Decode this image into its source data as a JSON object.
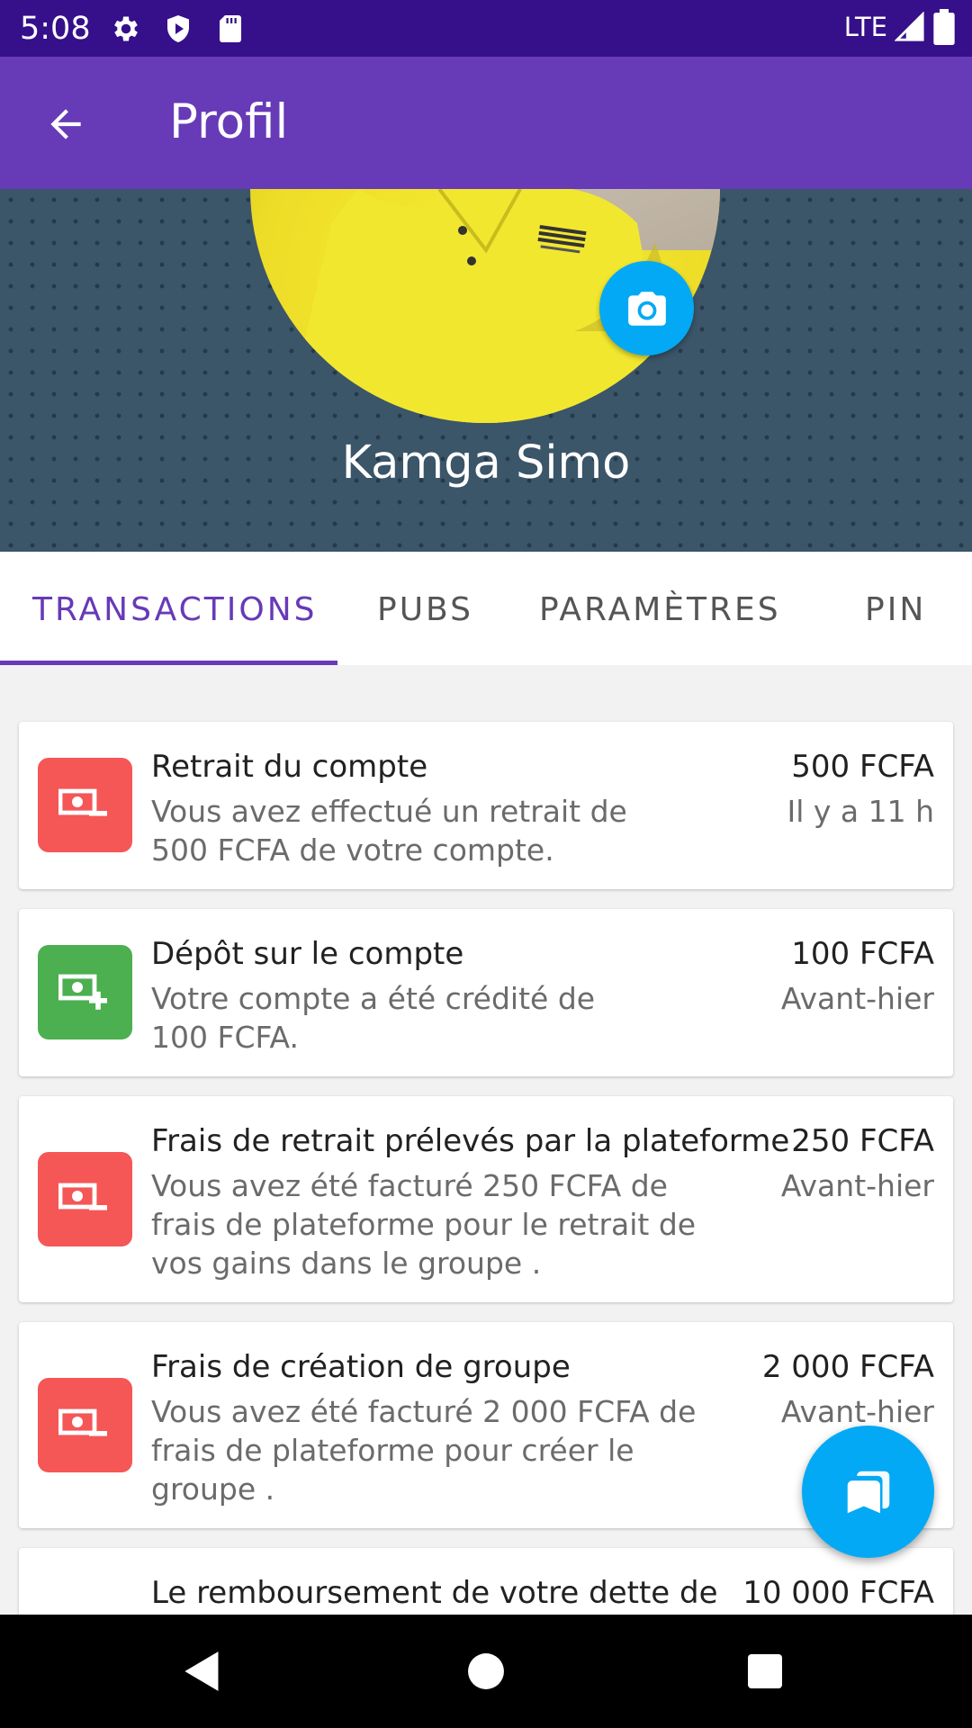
{
  "status_bar": {
    "time": "5:08",
    "network": "LTE",
    "icons": [
      "settings-icon",
      "shield-play-icon",
      "sd-card-icon",
      "signal-icon",
      "battery-icon"
    ]
  },
  "app_bar": {
    "title": "Profil",
    "back_icon": "arrow-back-icon",
    "color": "#673ab7"
  },
  "profile": {
    "name": "Kamga Simo",
    "camera_icon": "camera-icon"
  },
  "tabs": [
    {
      "label": "TRANSACTIONS",
      "active": true
    },
    {
      "label": "PUBS",
      "active": false
    },
    {
      "label": "PARAMÈTRES",
      "active": false
    },
    {
      "label": "PIN",
      "active": false
    }
  ],
  "transactions": [
    {
      "title": "Retrait du compte",
      "description": "Vous avez effectué un retrait de 500 FCFA de votre compte.",
      "amount": "500 FCFA",
      "time": "Il y a 11 h",
      "type": "withdrawal",
      "icon": "cash-minus-icon",
      "color": "#f55656"
    },
    {
      "title": "Dépôt sur le compte",
      "description": "Votre compte a été crédité de 100 FCFA.",
      "amount": "100 FCFA",
      "time": "Avant-hier",
      "type": "deposit",
      "icon": "cash-plus-icon",
      "color": "#4caf50"
    },
    {
      "title": "Frais de retrait prélevés par la plateforme",
      "description": "Vous avez été facturé 250 FCFA de frais de plateforme pour le retrait de vos gains dans le groupe .",
      "amount": "250 FCFA",
      "time": "Avant-hier",
      "type": "withdrawal",
      "icon": "cash-minus-icon",
      "color": "#f55656"
    },
    {
      "title": "Frais de création de groupe",
      "description": "Vous avez été facturé 2 000 FCFA de frais de plateforme pour créer le groupe .",
      "amount": "2 000 FCFA",
      "time": "Avant-hier",
      "type": "withdrawal",
      "icon": "cash-minus-icon",
      "color": "#f55656"
    },
    {
      "title": "Le remboursement de votre dette de",
      "amount": "10 000 FCFA"
    }
  ],
  "fab": {
    "icon": "copy-pages-icon",
    "color": "#03a9f4"
  },
  "nav_bar": {
    "icons": [
      "back-triangle-icon",
      "home-circle-icon",
      "recents-square-icon"
    ]
  }
}
